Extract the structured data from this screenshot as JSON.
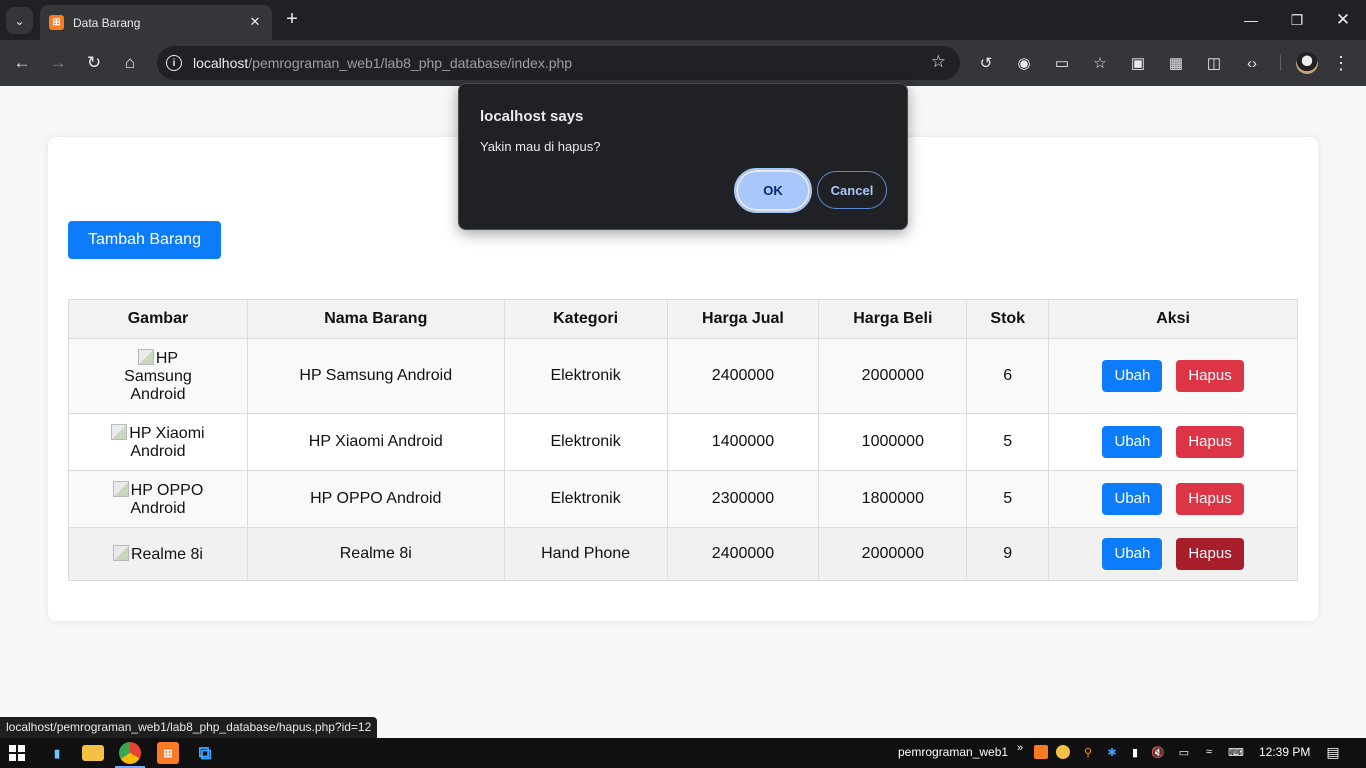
{
  "browser": {
    "tab_title": "Data Barang",
    "tab_favicon": "xampp-icon",
    "url_host": "localhost",
    "url_path": "/pemrograman_web1/lab8_php_database/index.php",
    "status_link": "localhost/pemrograman_web1/lab8_php_database/hapus.php?id=12"
  },
  "dialog": {
    "title": "localhost says",
    "message": "Yakin mau di hapus?",
    "ok_label": "OK",
    "cancel_label": "Cancel"
  },
  "page": {
    "add_button": "Tambah Barang",
    "columns": [
      "Gambar",
      "Nama Barang",
      "Kategori",
      "Harga Jual",
      "Harga Beli",
      "Stok",
      "Aksi"
    ],
    "rows": [
      {
        "image_alt": "HP Samsung Android",
        "name": "HP Samsung Android",
        "category": "Elektronik",
        "sell": "2400000",
        "buy": "2000000",
        "stock": "6",
        "edit": "Ubah",
        "delete": "Hapus"
      },
      {
        "image_alt": "HP Xiaomi Android",
        "name": "HP Xiaomi Android",
        "category": "Elektronik",
        "sell": "1400000",
        "buy": "1000000",
        "stock": "5",
        "edit": "Ubah",
        "delete": "Hapus"
      },
      {
        "image_alt": "HP OPPO Android",
        "name": "HP OPPO Android",
        "category": "Elektronik",
        "sell": "2300000",
        "buy": "1800000",
        "stock": "5",
        "edit": "Ubah",
        "delete": "Hapus"
      },
      {
        "image_alt": "Realme 8i",
        "name": "Realme 8i",
        "category": "Hand Phone",
        "sell": "2400000",
        "buy": "2000000",
        "stock": "9",
        "edit": "Ubah",
        "delete": "Hapus"
      }
    ]
  },
  "taskbar": {
    "folder_label": "pemrograman_web1",
    "time": "12:39 PM"
  },
  "colors": {
    "primary": "#0d7cfb",
    "danger": "#dc3545",
    "danger_active": "#a71d2a",
    "dialog_ok": "#a8c7fa"
  }
}
